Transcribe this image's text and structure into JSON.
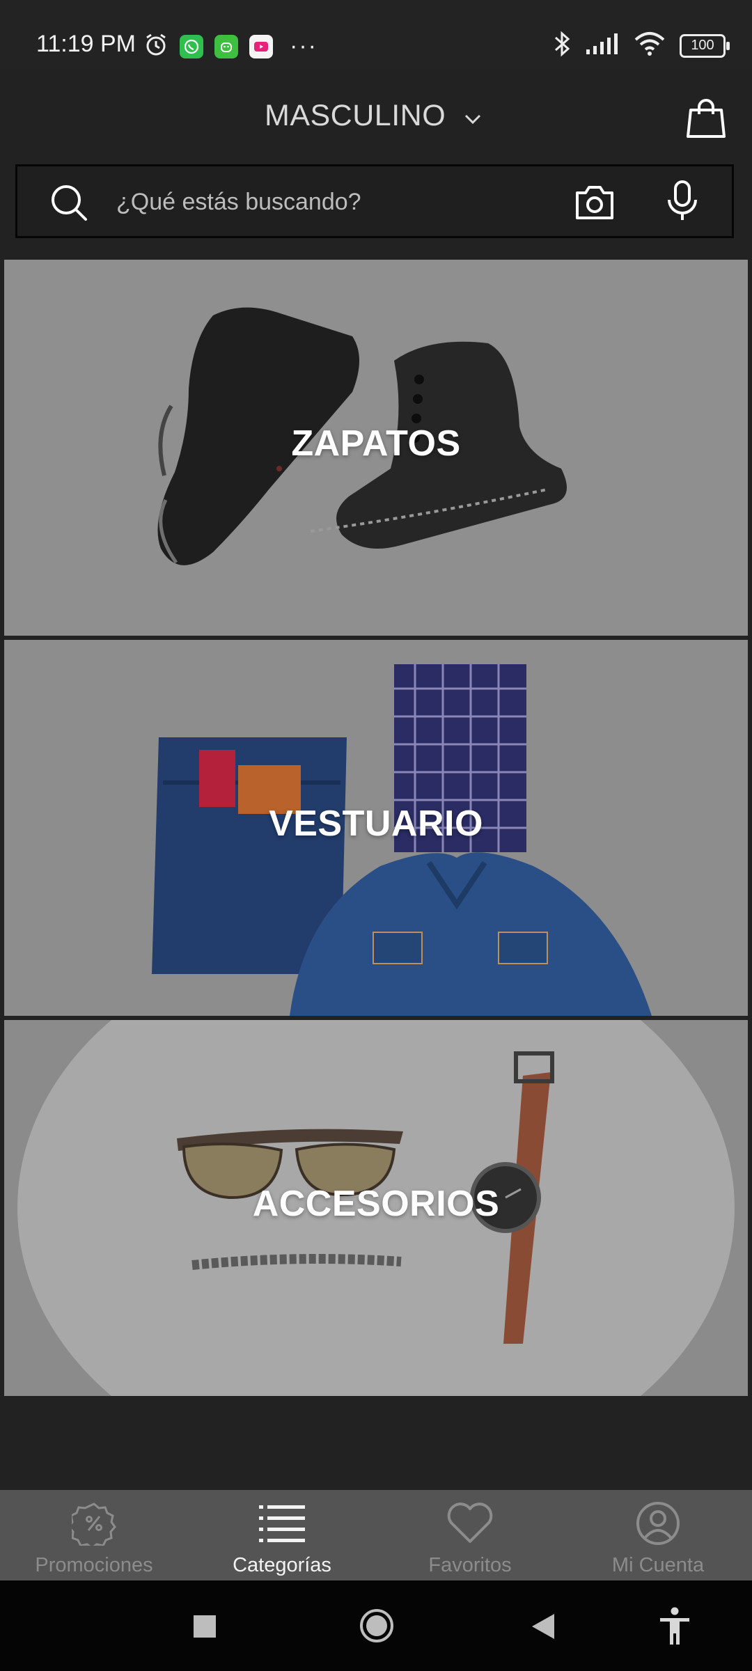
{
  "status_bar": {
    "time": "11:19 PM",
    "more_indicator": "···",
    "battery": "100",
    "icons": [
      "alarm-icon",
      "whatsapp-icon",
      "android-app-icon",
      "youtube-icon",
      "bluetooth-icon",
      "signal-icon",
      "wifi-icon",
      "battery-icon"
    ]
  },
  "header": {
    "gender_selector": "MASCULINO",
    "cart_icon": "shopping-bag-icon"
  },
  "search": {
    "placeholder": "¿Qué estás buscando?",
    "icons": [
      "search-icon",
      "camera-icon",
      "microphone-icon"
    ]
  },
  "categories": [
    {
      "label": "ZAPATOS"
    },
    {
      "label": "VESTUARIO"
    },
    {
      "label": "ACCESORIOS"
    }
  ],
  "bottom_nav": {
    "items": [
      {
        "label": "Promociones",
        "icon": "discount-badge-icon",
        "active": false
      },
      {
        "label": "Categorías",
        "icon": "list-icon",
        "active": true
      },
      {
        "label": "Favoritos",
        "icon": "heart-icon",
        "active": false
      },
      {
        "label": "Mi Cuenta",
        "icon": "account-icon",
        "active": false
      }
    ]
  },
  "system_nav": {
    "icons": [
      "recents-square-icon",
      "home-circle-icon",
      "back-triangle-icon",
      "accessibility-icon"
    ]
  },
  "colors": {
    "background": "#222222",
    "bottom_nav_background": "#545454",
    "active_nav_text": "#f3f3f3",
    "inactive_nav_text": "#8c8c8c"
  }
}
